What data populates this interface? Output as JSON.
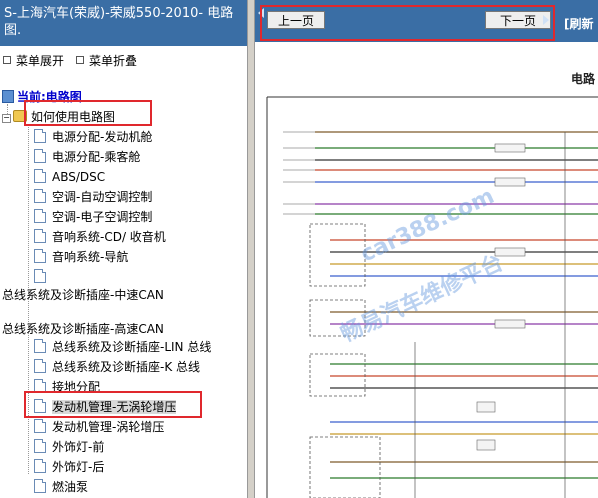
{
  "left_panel": {
    "title": "S-上海汽车(荣威)-荣威550-2010- 电路图.",
    "expand_label": "菜单展开",
    "collapse_label": "菜单折叠",
    "current_label": "当前:电路图",
    "tree": [
      {
        "label": "如何使用电路图"
      },
      {
        "label": "电源分配-发动机舱"
      },
      {
        "label": "电源分配-乘客舱"
      },
      {
        "label": "ABS/DSC"
      },
      {
        "label": "空调-自动空调控制"
      },
      {
        "label": "空调-电子空调控制"
      },
      {
        "label": "音响系统-CD/ 收音机"
      },
      {
        "label": "音响系统-导航"
      },
      {
        "label": ""
      },
      {
        "label": "总线系统及诊断插座-中速CAN"
      },
      {
        "label": "总线系统及诊断插座-高速CAN"
      },
      {
        "label": "总线系统及诊断插座-LIN 总线"
      },
      {
        "label": "总线系统及诊断插座-K 总线"
      },
      {
        "label": "接地分配"
      },
      {
        "label": "发动机管理-无涡轮增压"
      },
      {
        "label": "发动机管理-涡轮增压"
      },
      {
        "label": "外饰灯-前"
      },
      {
        "label": "外饰灯-后"
      },
      {
        "label": "燃油泵"
      }
    ]
  },
  "right_panel": {
    "prev_label": "上一页",
    "next_label": "下一页",
    "refresh_label": "[刷新",
    "diagram_title": "电路"
  },
  "colors": {
    "header_blue": "#3a6ea5",
    "highlight_red": "#e0282d",
    "divider": "#d4d0c8"
  }
}
